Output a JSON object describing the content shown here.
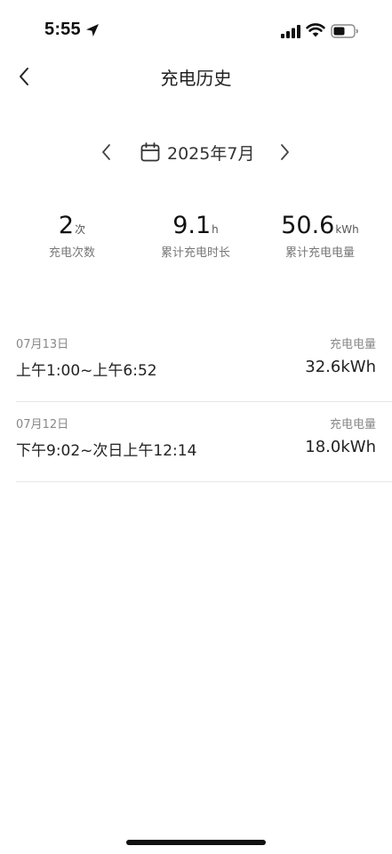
{
  "status_bar": {
    "time": "5:55",
    "icons": [
      "location-arrow-icon",
      "cellular-signal-icon",
      "wifi-icon",
      "battery-icon"
    ]
  },
  "nav": {
    "back_icon": "chevron-left-icon",
    "title": "充电历史"
  },
  "month_selector": {
    "prev_icon": "chevron-left-icon",
    "calendar_icon": "calendar-icon",
    "label": "2025年7月",
    "next_icon": "chevron-right-icon"
  },
  "stats": [
    {
      "value": "2",
      "unit": "次",
      "label": "充电次数"
    },
    {
      "value": "9.1",
      "unit": "h",
      "label": "累计充电时长"
    },
    {
      "value": "50.6",
      "unit": "kWh",
      "label": "累计充电电量"
    }
  ],
  "records": [
    {
      "date": "07月13日",
      "time_range": "上午1:00~上午6:52",
      "energy_label": "充电电量",
      "energy": "32.6kWh"
    },
    {
      "date": "07月12日",
      "time_range": "下午9:02~次日上午12:14",
      "energy_label": "充电电量",
      "energy": "18.0kWh"
    }
  ],
  "colors": {
    "background": "#ffffff",
    "primary_text": "#222222",
    "secondary_text": "#888888",
    "divider": "#e6e6e6"
  }
}
